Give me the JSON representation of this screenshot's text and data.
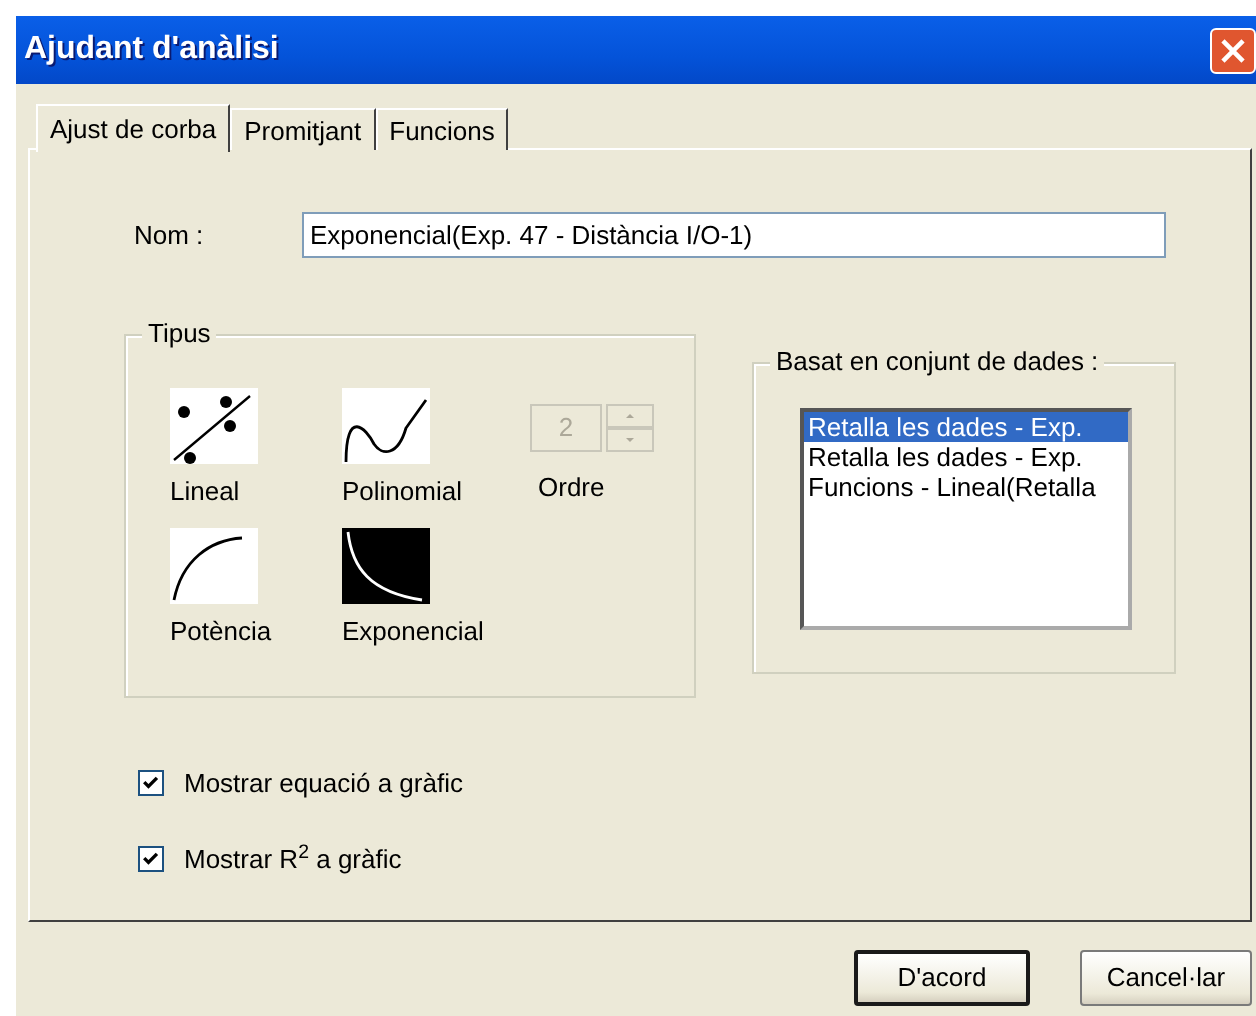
{
  "window": {
    "title": "Ajudant d'anàlisi"
  },
  "tabs": [
    {
      "label": "Ajust de corba",
      "selected": true
    },
    {
      "label": "Promitjant",
      "selected": false
    },
    {
      "label": "Funcions",
      "selected": false
    }
  ],
  "name_field": {
    "label": "Nom :",
    "value": "Exponencial(Exp. 47 - Distància I/O-1)"
  },
  "type_group": {
    "title": "Tipus",
    "options": [
      {
        "kind": "linear",
        "label": "Lineal",
        "selected": false
      },
      {
        "kind": "polynomial",
        "label": "Polinomial",
        "selected": false
      },
      {
        "kind": "order",
        "label": "Ordre",
        "value": "2",
        "disabled": true
      },
      {
        "kind": "power",
        "label": "Potència",
        "selected": false
      },
      {
        "kind": "exponential",
        "label": "Exponencial",
        "selected": true
      }
    ]
  },
  "dataset_group": {
    "title": "Basat en conjunt de dades :",
    "items": [
      {
        "label": "Retalla les dades - Exp.",
        "selected": true
      },
      {
        "label": "Retalla les dades - Exp.",
        "selected": false
      },
      {
        "label": "Funcions - Lineal(Retalla",
        "selected": false
      }
    ]
  },
  "checkboxes": [
    {
      "label": "Mostrar equació a gràfic",
      "checked": true
    },
    {
      "label": "Mostrar R$^{2}$ a gràfic",
      "checked": true
    }
  ],
  "buttons": [
    {
      "label": "D'acord",
      "default": true
    },
    {
      "label": "Cancel·lar",
      "default": false
    }
  ]
}
